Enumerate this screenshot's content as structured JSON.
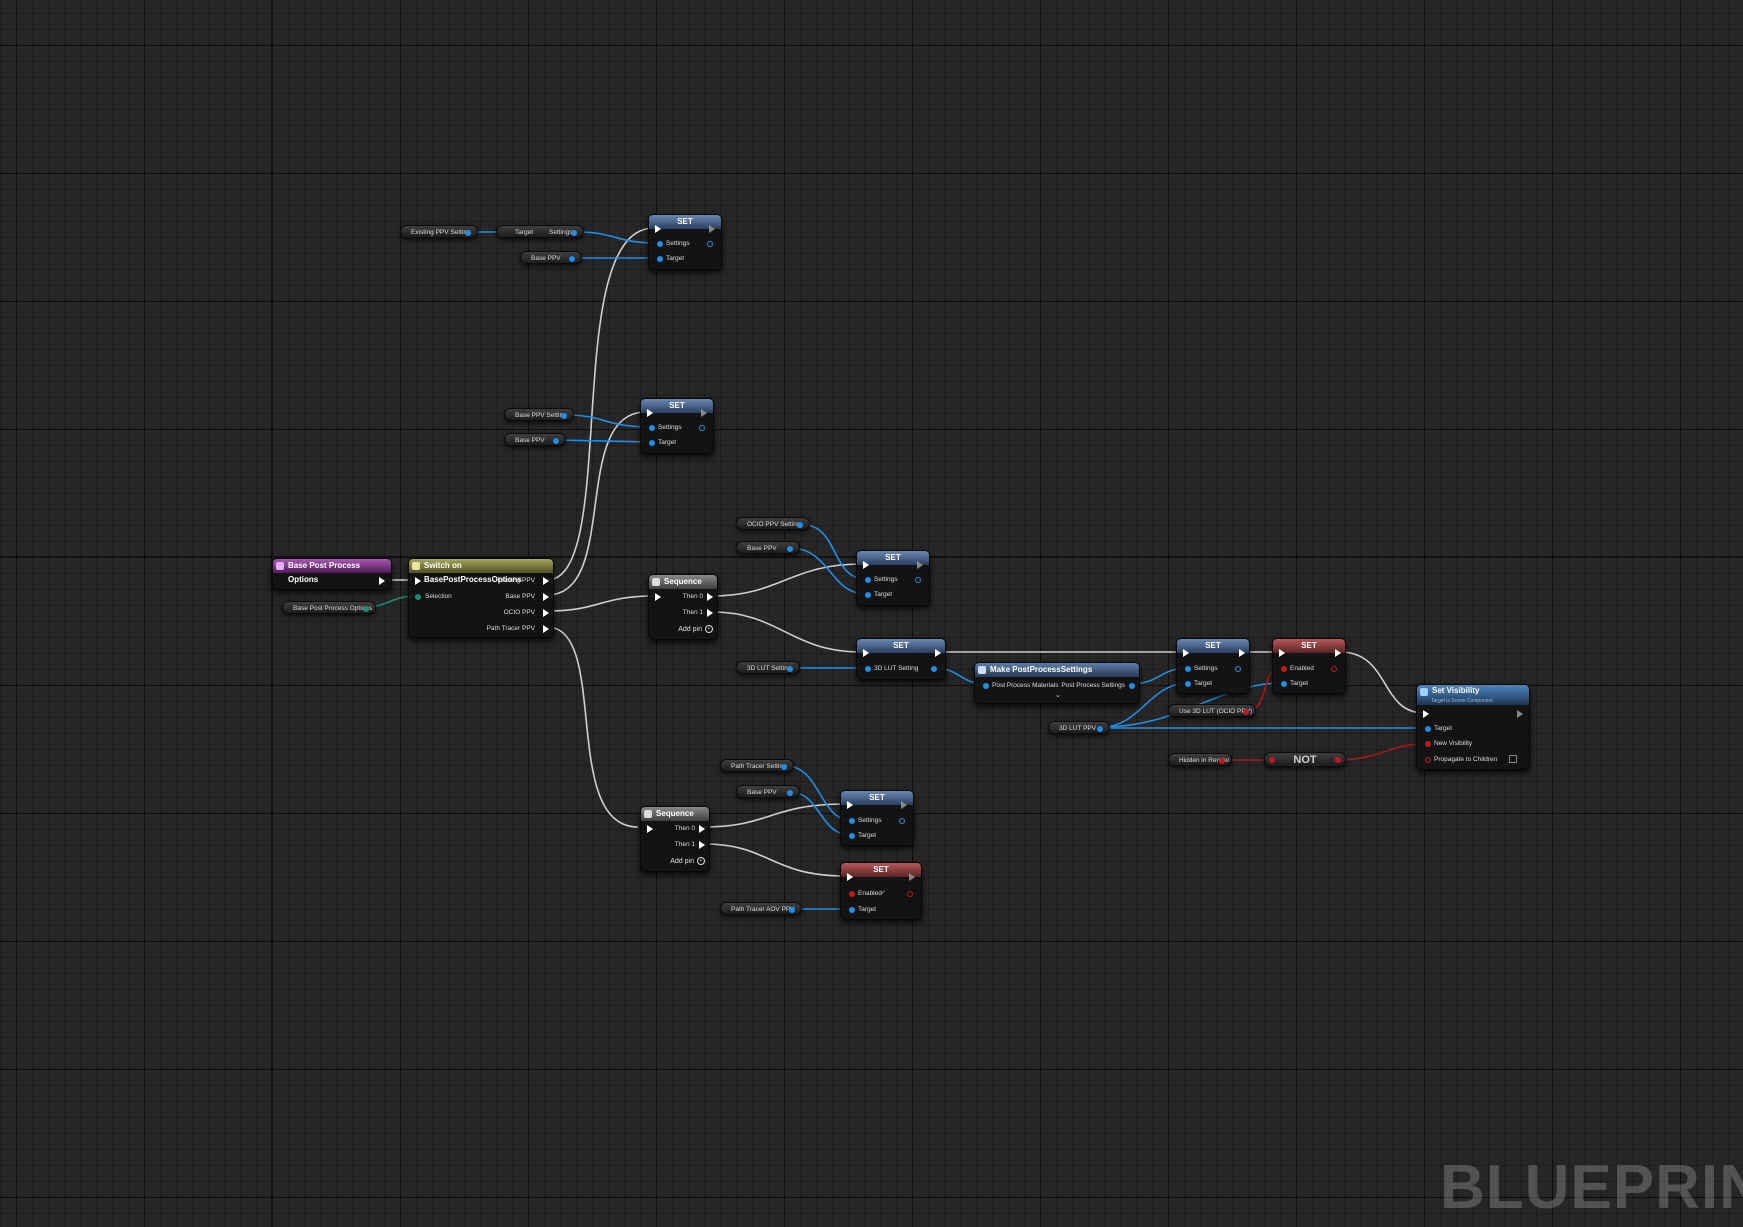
{
  "watermark": "BLUEPRINT",
  "colors": {
    "object_pin": "#1f8ee8",
    "bool_pin": "#c21a1a",
    "enum_pin": "#1a8c73",
    "exec": "#ffffff"
  },
  "nodes": {
    "base_post_process_options_event": {
      "title": "Base Post Process Options"
    },
    "base_post_process_options_var": {
      "label": "Base Post Process Options"
    },
    "switch": {
      "title": "Switch on BasePostProcessOptions",
      "selection": "Selection",
      "outputs": [
        "Existing PPV",
        "Base PPV",
        "OCIO PPV",
        "Path Tracer PPV"
      ]
    },
    "existing_ppv_setting": {
      "label": "Existing PPV Setting"
    },
    "break_target": {
      "target": "Target",
      "settings": "Settings"
    },
    "base_ppv_1": {
      "label": "Base PPV"
    },
    "set_1": {
      "title": "SET",
      "settings": "Settings",
      "target": "Target"
    },
    "base_ppv_setting": {
      "label": "Base PPV Setting"
    },
    "base_ppv_2": {
      "label": "Base PPV"
    },
    "set_2": {
      "title": "SET",
      "settings": "Settings",
      "target": "Target"
    },
    "ocio_ppv_setting": {
      "label": "OCIO PPV Setting"
    },
    "base_ppv_3": {
      "label": "Base PPV"
    },
    "set_3": {
      "title": "SET",
      "settings": "Settings",
      "target": "Target"
    },
    "sequence_1": {
      "title": "Sequence",
      "then0": "Then 0",
      "then1": "Then 1",
      "add_pin": "Add pin"
    },
    "lut_setting": {
      "label": "3D LUT Setting"
    },
    "set_lut": {
      "title": "SET",
      "pin": "3D LUT Setting"
    },
    "make_pps": {
      "title": "Make PostProcessSettings",
      "input": "Post Process Materials",
      "output": "Post Process Settings"
    },
    "set_5": {
      "title": "SET",
      "settings": "Settings",
      "target": "Target"
    },
    "set_enabled": {
      "title": "SET",
      "enabled": "Enabled",
      "target": "Target"
    },
    "use_3d_lut": {
      "label": "Use 3D LUT (OCIO PPV)"
    },
    "lut_ppv": {
      "label": "3D LUT PPV"
    },
    "hidden_in_render": {
      "label": "Hidden in Render"
    },
    "not_node": {
      "label": "NOT"
    },
    "set_visibility": {
      "title": "Set Visibility",
      "subtitle": "Target is Scene Component",
      "target": "Target",
      "new_visibility": "New Visibility",
      "propagate": "Propagate to Children"
    },
    "path_tracer_setting": {
      "label": "Path Tracer Setting"
    },
    "base_ppv_4": {
      "label": "Base PPV"
    },
    "set_6": {
      "title": "SET",
      "settings": "Settings",
      "target": "Target"
    },
    "sequence_2": {
      "title": "Sequence",
      "then0": "Then 0",
      "then1": "Then 1",
      "add_pin": "Add pin"
    },
    "set_7": {
      "title": "SET",
      "enabled": "Enabled",
      "target": "Target"
    },
    "path_tracer_aov_ppv": {
      "label": "Path Tracer AOV PPV"
    }
  }
}
